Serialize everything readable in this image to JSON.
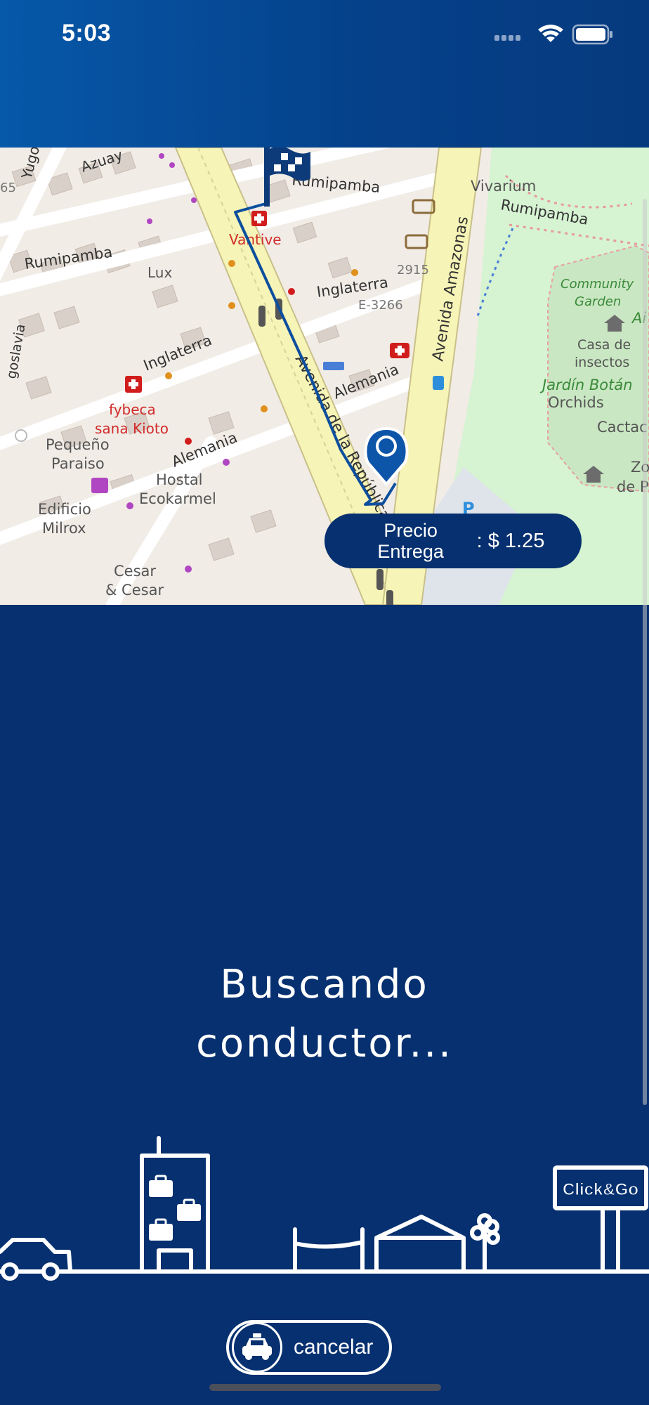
{
  "status_bar": {
    "time": "5:03",
    "icons": [
      "cellular-signal-icon",
      "wifi-icon",
      "battery-icon"
    ]
  },
  "map": {
    "labels": {
      "street_azuay": "Azuay",
      "street_yugo": "Yugo",
      "street_rumipamba_top": "Rumipamba",
      "street_rumipamba_left": "Rumipamba",
      "street_rumipamba_right": "Rumipamba",
      "street_inglaterra_top": "Inglaterra",
      "street_inglaterra_left": "Inglaterra",
      "street_alemania_mid": "Alemania",
      "street_alemania_left": "Alemania",
      "avenida_republica": "Avenida de la República",
      "avenida_amazonas": "Avenida Amazonas",
      "goslavia": "goslavia",
      "num_65": "65",
      "num_2915": "2915",
      "code_e3266": "E-3266",
      "poi_vantive": "Vantive",
      "poi_lux": "Lux",
      "poi_fybeca_1": "fybeca",
      "poi_fybeca_2": "sana Kioto",
      "poi_pequeno_1": "Pequeño",
      "poi_pequeno_2": "Paraiso",
      "poi_hostal_1": "Hostal",
      "poi_hostal_2": "Ecokarmel",
      "poi_edificio_1": "Edificio",
      "poi_edificio_2": "Milrox",
      "poi_cesar_1": "Cesar",
      "poi_cesar_2": "& Cesar",
      "poi_vivarium": "Vivarium",
      "poi_community_1": "Community",
      "poi_community_2": "Garden",
      "poi_casa_1": "Casa de",
      "poi_casa_2": "insectos",
      "poi_jardin": "Jardín Botán",
      "poi_orchids": "Orchids",
      "poi_cactac": "Cactac",
      "poi_zo": "Zo",
      "poi_dep": "de P",
      "poi_ai": "Ai"
    },
    "origin_marker": "flag-icon",
    "destination_marker": "location-pin-icon",
    "route_color": "#0d4f9e"
  },
  "price": {
    "label": "Precio Entrega",
    "value": ": $ 1.25"
  },
  "status_message": {
    "line1": "Buscando",
    "line2": "conductor..."
  },
  "skyline": {
    "billboard_text": "Click&Go"
  },
  "cancel_button": {
    "label": "cancelar",
    "icon": "taxi-icon"
  },
  "colors": {
    "background": "#06306f",
    "header_gradient_start": "#0658a9",
    "header_gradient_end": "#063a7e",
    "park": "#d6f3d2",
    "avenue": "#f6f4b6"
  }
}
